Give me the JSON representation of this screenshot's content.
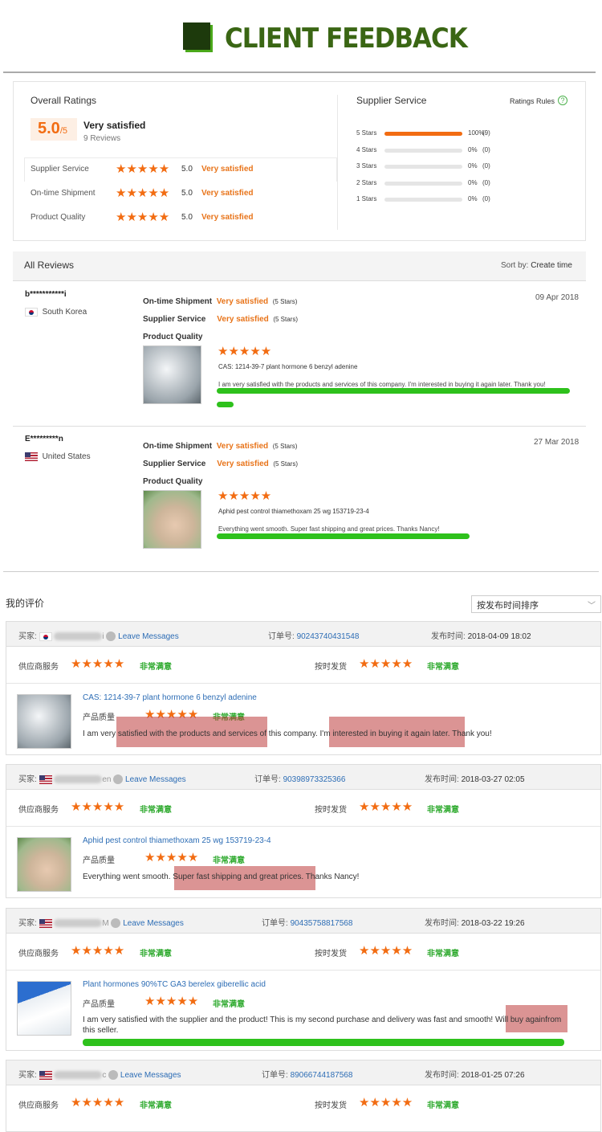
{
  "header": {
    "title": "CLIENT FEEDBACK"
  },
  "overall": {
    "label": "Overall Ratings",
    "score": "5.0",
    "score_suffix": "/5",
    "summary": "Very satisfied",
    "reviews": "9 Reviews",
    "rows": [
      {
        "name": "Supplier Service",
        "value": "5.0",
        "text": "Very satisfied"
      },
      {
        "name": "On-time Shipment",
        "value": "5.0",
        "text": "Very satisfied"
      },
      {
        "name": "Product Quality",
        "value": "5.0",
        "text": "Very satisfied"
      }
    ]
  },
  "supplier_service": {
    "title": "Supplier Service",
    "rules": "Ratings Rules",
    "help": "?",
    "bars": [
      {
        "label": "5 Stars",
        "pct": "100%",
        "count": "(9)",
        "fill": 1
      },
      {
        "label": "4 Stars",
        "pct": "0%",
        "count": "(0)",
        "fill": 0
      },
      {
        "label": "3 Stars",
        "pct": "0%",
        "count": "(0)",
        "fill": 0
      },
      {
        "label": "2 Stars",
        "pct": "0%",
        "count": "(0)",
        "fill": 0
      },
      {
        "label": "1 Stars",
        "pct": "0%",
        "count": "(0)",
        "fill": 0
      }
    ]
  },
  "all_reviews": {
    "title": "All Reviews",
    "sort_label": "Sort by:",
    "sort_value": "Create time"
  },
  "reviews": [
    {
      "user": "b***********i",
      "country": "South Korea",
      "date": "09 Apr 2018",
      "ontime_label": "On-time Shipment",
      "supplier_label": "Supplier Service",
      "quality_label": "Product Quality",
      "rating_text": "Very satisfied",
      "rating_stars": "(5 Stars)",
      "product": "CAS: 1214-39-7 plant hormone 6 benzyl adenine",
      "comment": "I am very satisfied with the products and services of this company. I'm interested in buying it again later. Thank you!"
    },
    {
      "user": "E*********n",
      "country": "United States",
      "date": "27 Mar 2018",
      "ontime_label": "On-time Shipment",
      "supplier_label": "Supplier Service",
      "quality_label": "Product Quality",
      "rating_text": "Very satisfied",
      "rating_stars": "(5 Stars)",
      "product": "Aphid pest control thiamethoxam 25 wg 153719-23-4",
      "comment": "Everything went smooth. Super fast shipping and great prices. Thanks Nancy!"
    }
  ],
  "cn": {
    "title": "我的评价",
    "sort": "按发布时间排序",
    "buyer_label": "买家:",
    "leave": "Leave Messages",
    "order_label": "订单号:",
    "time_label": "发布时间:",
    "supplier_label": "供应商服务",
    "ontime_label": "按时发货",
    "quality_label": "产品质量",
    "rating": "非常满意",
    "orders": [
      {
        "name_tail": "i",
        "order": "90243740431548",
        "time": "2018-04-09 18:02",
        "product": "CAS: 1214-39-7 plant hormone 6 benzyl adenine",
        "c1": "I am very ",
        "c2": "satisfied with the products and services",
        "c3": " of this company. ",
        "c4": "I'm interested in buying it again later.",
        "c5": " Thank you!"
      },
      {
        "name_tail": "en",
        "order": "90398973325366",
        "time": "2018-03-27 02:05",
        "product": "Aphid pest control thiamethoxam 25 wg 153719-23-4",
        "c1": "Everything went smooth. ",
        "c2": "Super fast shipping and great prices.",
        "c3": " Thanks Nancy!"
      },
      {
        "name_tail": "M",
        "order": "90435758817568",
        "time": "2018-03-22 19:26",
        "product": "Plant hormones 90%TC GA3 berelex giberellic acid",
        "c1": "I am very satisfied with the supplier and the product! This is my second purchase and delivery was fast and smooth! ",
        "c2": "Will buy again",
        "c3": "from this seller."
      },
      {
        "name_tail": "c",
        "order": "89066744187568",
        "time": "2018-01-25 07:26"
      }
    ]
  },
  "colors": {
    "accent": "#f26c12",
    "title_green": "#3a6614",
    "highlight_green": "#2ec11c",
    "link": "#2d6db5"
  }
}
